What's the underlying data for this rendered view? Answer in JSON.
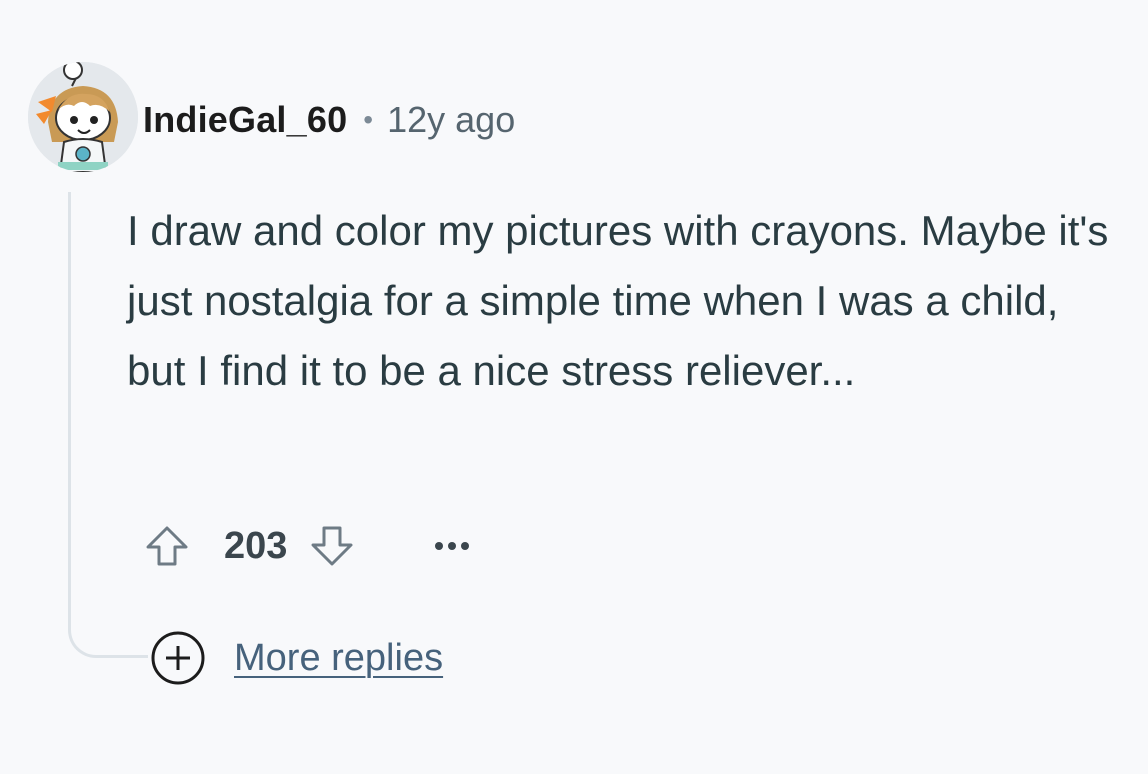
{
  "comment": {
    "author": "IndieGal_60",
    "separator": "•",
    "timestamp": "12y ago",
    "body": "I draw and color my pictures with crayons. Maybe it's just nostalgia for a simple time when I was a child, but I find it to be a nice stress reliever...",
    "score": "203",
    "avatar_icon": "snoo-avatar-icon",
    "upvote_icon": "upvote-arrow-icon",
    "downvote_icon": "downvote-arrow-icon",
    "overflow_icon": "ellipsis-icon"
  },
  "more_replies": {
    "label": "More replies",
    "icon": "plus-circle-icon"
  },
  "colors": {
    "background": "#f8f9fb",
    "thread_line": "#dde3e8",
    "text": "#2a3c42",
    "link": "#46627c",
    "muted": "#56656f"
  }
}
